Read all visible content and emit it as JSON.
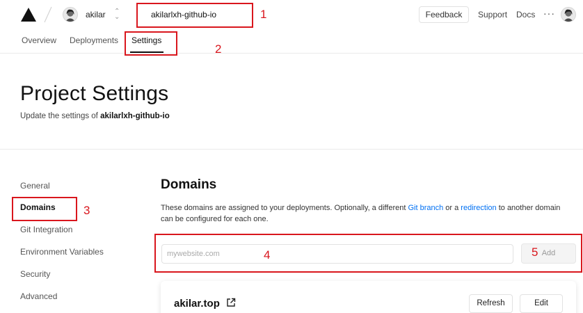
{
  "topbar": {
    "user_name": "akilar",
    "project_name": "akilarlxh-github-io",
    "feedback_label": "Feedback",
    "support_label": "Support",
    "docs_label": "Docs",
    "more_label": "···"
  },
  "tabs": [
    {
      "label": "Overview"
    },
    {
      "label": "Deployments"
    },
    {
      "label": "Settings"
    }
  ],
  "header": {
    "title": "Project Settings",
    "subtitle_prefix": "Update the settings of ",
    "subtitle_project": "akilarlxh-github-io"
  },
  "sidebar": {
    "items": [
      {
        "label": "General"
      },
      {
        "label": "Domains"
      },
      {
        "label": "Git Integration"
      },
      {
        "label": "Environment Variables"
      },
      {
        "label": "Security"
      },
      {
        "label": "Advanced"
      }
    ]
  },
  "domains": {
    "title": "Domains",
    "desc_part1": "These domains are assigned to your deployments. Optionally, a different ",
    "desc_link1": "Git branch",
    "desc_part2": " or a ",
    "desc_link2": "redirection",
    "desc_part3": " to another domain can be configured for each one.",
    "input_placeholder": "mywebsite.com",
    "input_value": "",
    "add_label": "Add",
    "card": {
      "domain": "akilar.top",
      "refresh_label": "Refresh",
      "edit_label": "Edit"
    }
  },
  "annotations": {
    "n1": "1",
    "n2": "2",
    "n3": "3",
    "n4": "4",
    "n5": "5"
  },
  "colors": {
    "accent_link": "#0070f3",
    "annotation_red": "#d9161d",
    "text_primary": "#111111"
  },
  "icons": [
    "vercel-logo-icon",
    "slash-separator-icon",
    "updown-chevron-icon",
    "external-link-icon",
    "avatar"
  ]
}
